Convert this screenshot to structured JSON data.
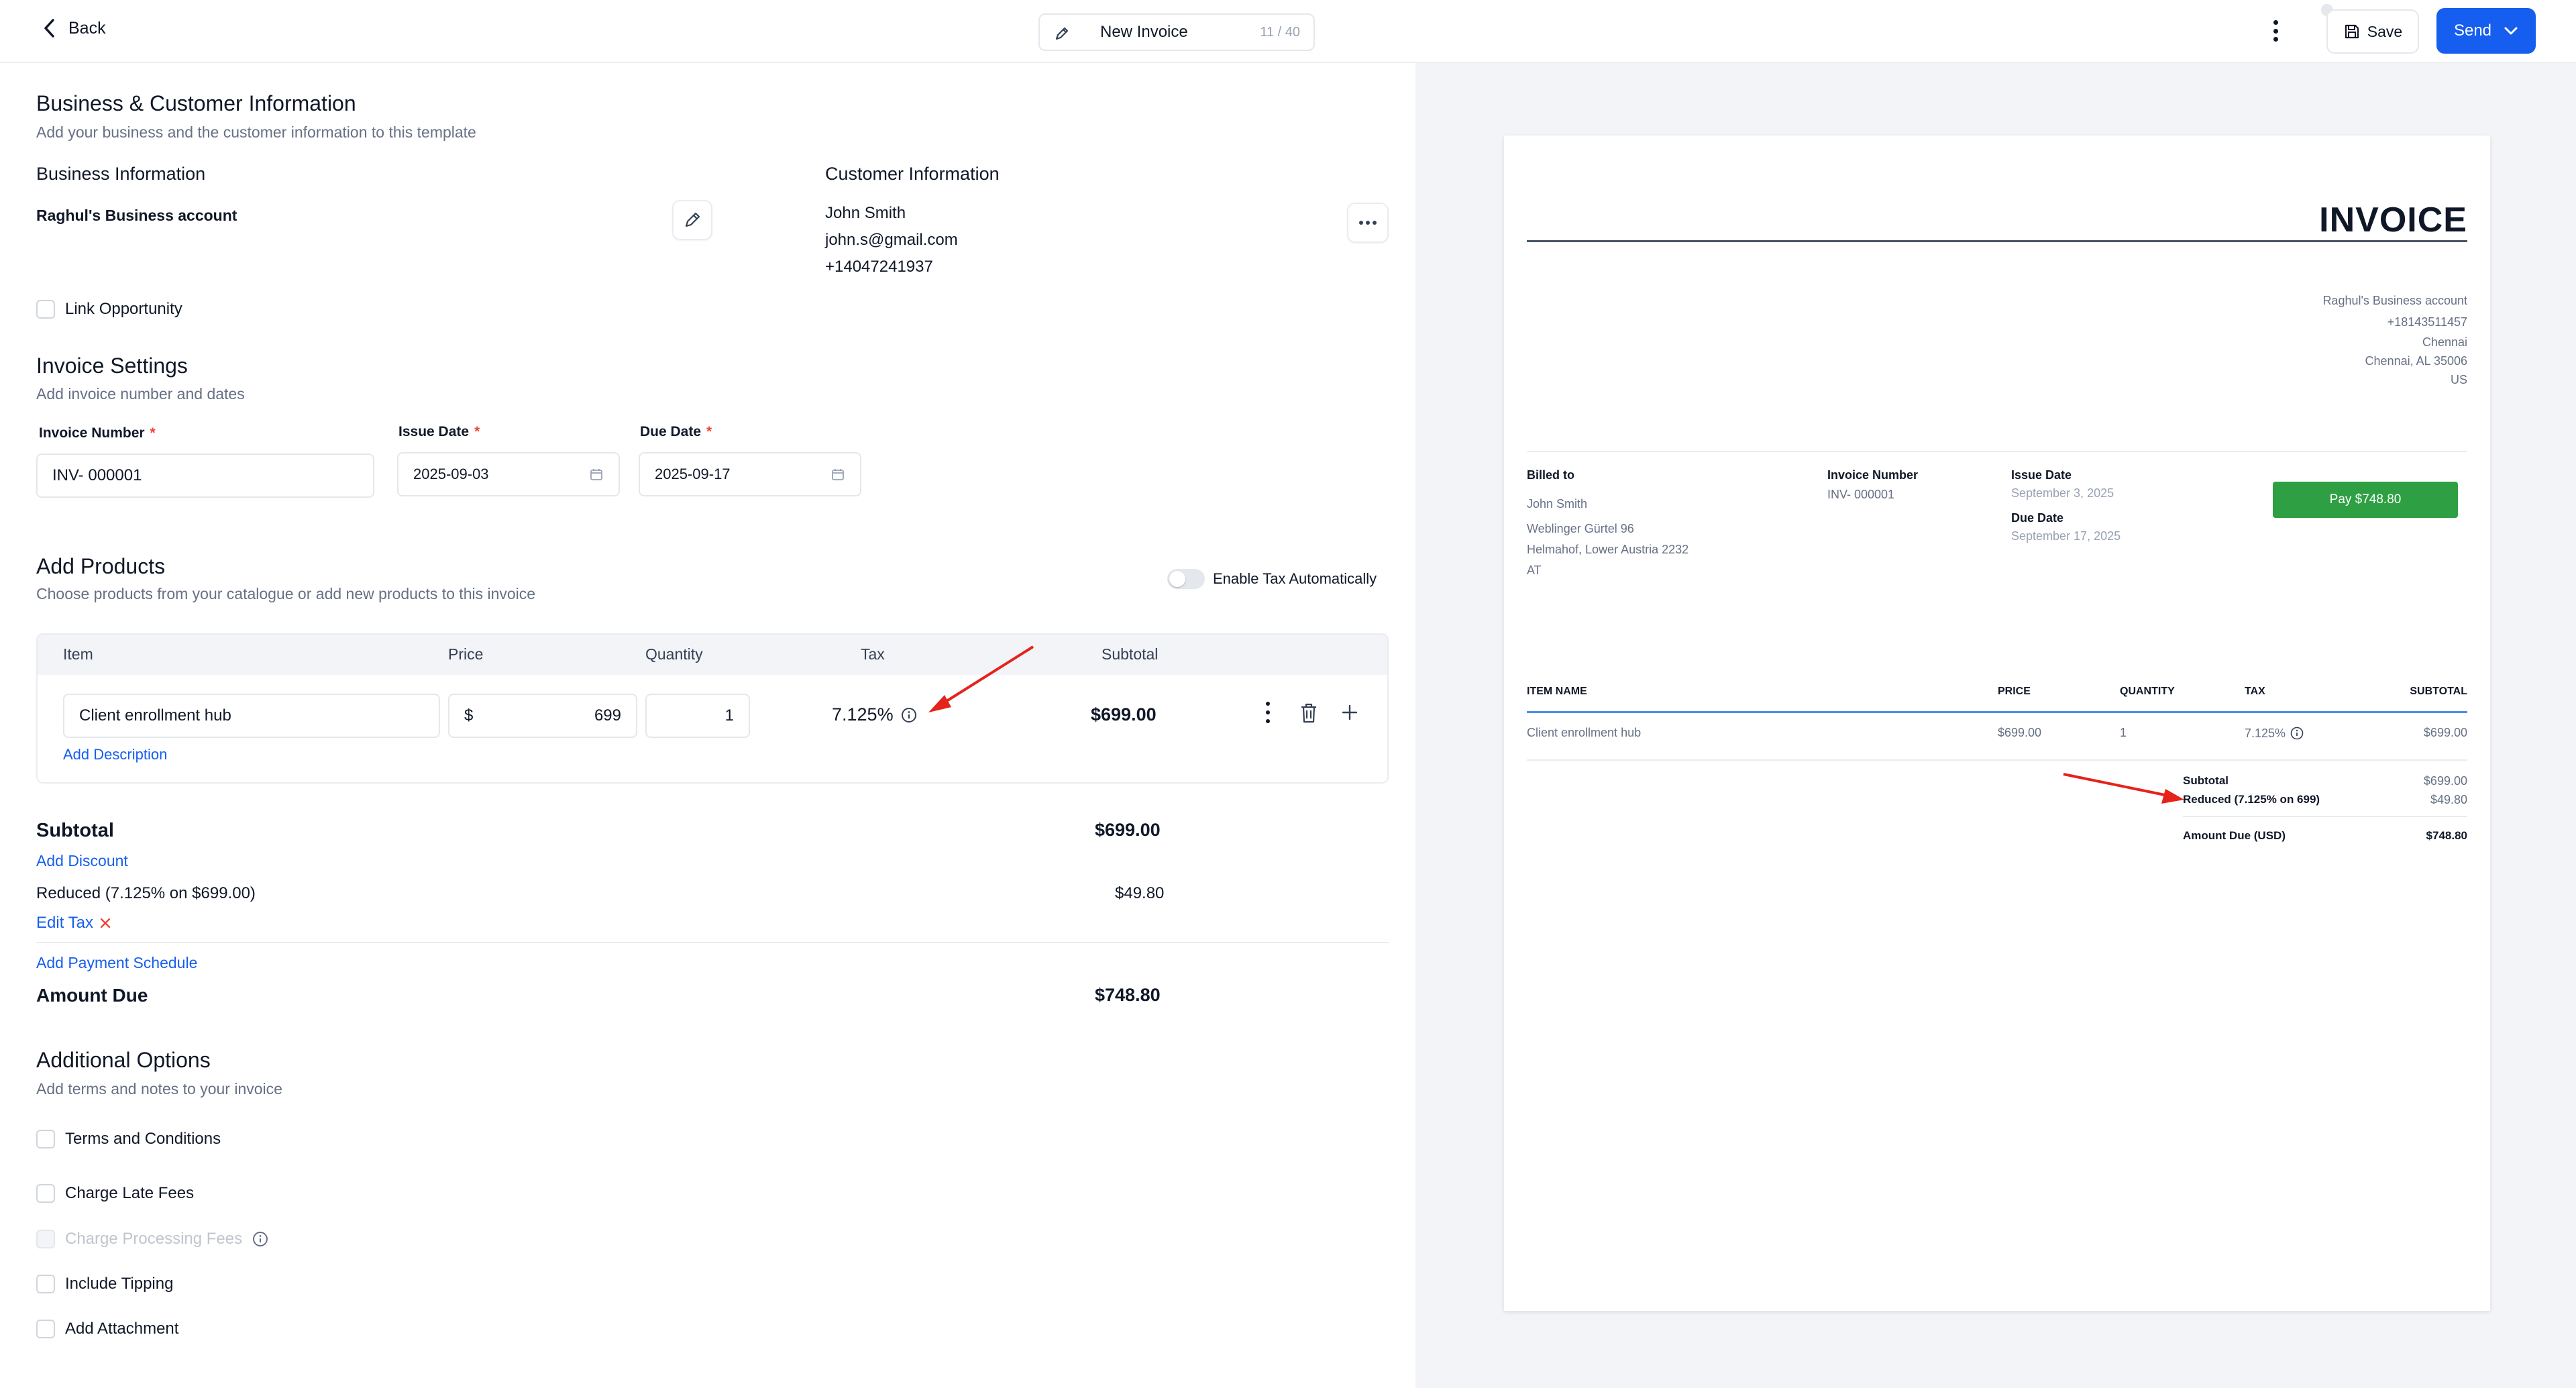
{
  "topbar": {
    "back_label": "Back",
    "invoice_title": "New Invoice",
    "char_count": "11 / 40",
    "save_label": "Save",
    "send_label": "Send"
  },
  "business_customer": {
    "title": "Business & Customer Information",
    "subtitle": "Add your business and the customer information to this template",
    "business_heading": "Business Information",
    "business_name": "Raghul's Business account",
    "customer_heading": "Customer Information",
    "customer_name": "John Smith",
    "customer_email": "john.s@gmail.com",
    "customer_phone": "+14047241937",
    "link_opportunity_label": "Link Opportunity"
  },
  "invoice_settings": {
    "title": "Invoice Settings",
    "subtitle": "Add invoice number and dates",
    "invoice_number_label": "Invoice Number",
    "invoice_number_value": "INV- 000001",
    "issue_date_label": "Issue Date",
    "issue_date_value": "2025-09-03",
    "due_date_label": "Due Date",
    "due_date_value": "2025-09-17",
    "required_mark": "*"
  },
  "products": {
    "title": "Add Products",
    "subtitle": "Choose products from your catalogue or add new products to this invoice",
    "enable_tax_label": "Enable Tax Automatically",
    "columns": {
      "item": "Item",
      "price": "Price",
      "quantity": "Quantity",
      "tax": "Tax",
      "subtotal": "Subtotal"
    },
    "rows": [
      {
        "item": "Client enrollment hub",
        "currency_symbol": "$",
        "price": "699",
        "quantity": "1",
        "tax": "7.125%",
        "subtotal": "$699.00",
        "add_description_label": "Add Description"
      }
    ]
  },
  "totals": {
    "subtotal_label": "Subtotal",
    "subtotal_value": "$699.00",
    "add_discount_label": "Add Discount",
    "tax_line_label": "Reduced (7.125% on $699.00)",
    "tax_line_value": "$49.80",
    "edit_tax_label": "Edit Tax",
    "add_payment_schedule_label": "Add Payment Schedule",
    "amount_due_label": "Amount Due",
    "amount_due_value": "$748.80"
  },
  "additional_options": {
    "title": "Additional Options",
    "subtitle": "Add terms and notes to your invoice",
    "options": [
      {
        "label": "Terms and Conditions"
      },
      {
        "label": "Charge Late Fees"
      },
      {
        "label": "Charge Processing Fees"
      },
      {
        "label": "Include Tipping"
      },
      {
        "label": "Add Attachment"
      }
    ]
  },
  "preview": {
    "heading": "INVOICE",
    "business": {
      "name": "Raghul's Business account",
      "phone": "+18143511457",
      "city": "Chennai",
      "city_state_zip": "Chennai, AL 35006",
      "country": "US"
    },
    "billed_to_label": "Billed to",
    "billed_to": {
      "name": "John Smith",
      "street": "Weblinger Gürtel 96",
      "region": "Helmahof, Lower Austria 2232",
      "country": "AT"
    },
    "invoice_number_label": "Invoice Number",
    "invoice_number": "INV- 000001",
    "issue_date_label": "Issue Date",
    "issue_date": "September 3, 2025",
    "due_date_label": "Due Date",
    "due_date": "September 17, 2025",
    "pay_button_label": "Pay $748.80",
    "table_headers": {
      "item_name": "ITEM NAME",
      "price": "PRICE",
      "quantity": "QUANTITY",
      "tax": "TAX",
      "subtotal": "SUBTOTAL"
    },
    "rows": [
      {
        "item_name": "Client enrollment hub",
        "price": "$699.00",
        "quantity": "1",
        "tax": "7.125%",
        "subtotal": "$699.00"
      }
    ],
    "subtotal_label": "Subtotal",
    "subtotal_value": "$699.00",
    "tax_label": "Reduced (7.125% on 699)",
    "tax_value": "$49.80",
    "amount_due_label": "Amount Due (USD)",
    "amount_due_value": "$748.80"
  },
  "colors": {
    "primary": "#155eef",
    "pay_green": "#2ea043",
    "annotation_red": "#e5231b",
    "required_red": "#f04438"
  }
}
